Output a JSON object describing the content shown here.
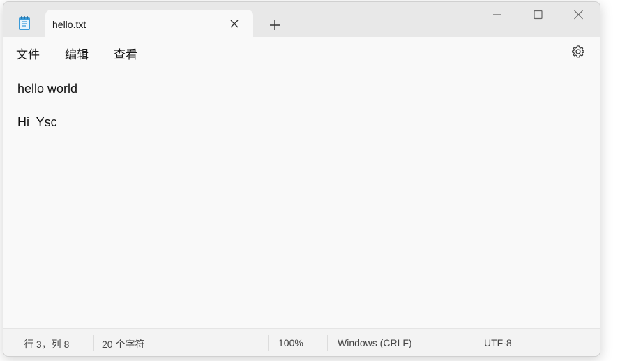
{
  "tab": {
    "title": "hello.txt"
  },
  "menu": {
    "file": "文件",
    "edit": "编辑",
    "view": "查看"
  },
  "editor": {
    "lines": [
      "hello world",
      "",
      "Hi  Ysc"
    ]
  },
  "status": {
    "position": "行 3，列 8",
    "char_count": "20 个字符",
    "zoom": "100%",
    "line_ending": "Windows (CRLF)",
    "encoding": "UTF-8"
  },
  "icons": {
    "app": "notepad-icon",
    "close_tab": "close-icon",
    "new_tab": "plus-icon",
    "minimize": "minimize-icon",
    "maximize": "maximize-icon",
    "close_window": "close-icon",
    "settings": "gear-icon"
  }
}
